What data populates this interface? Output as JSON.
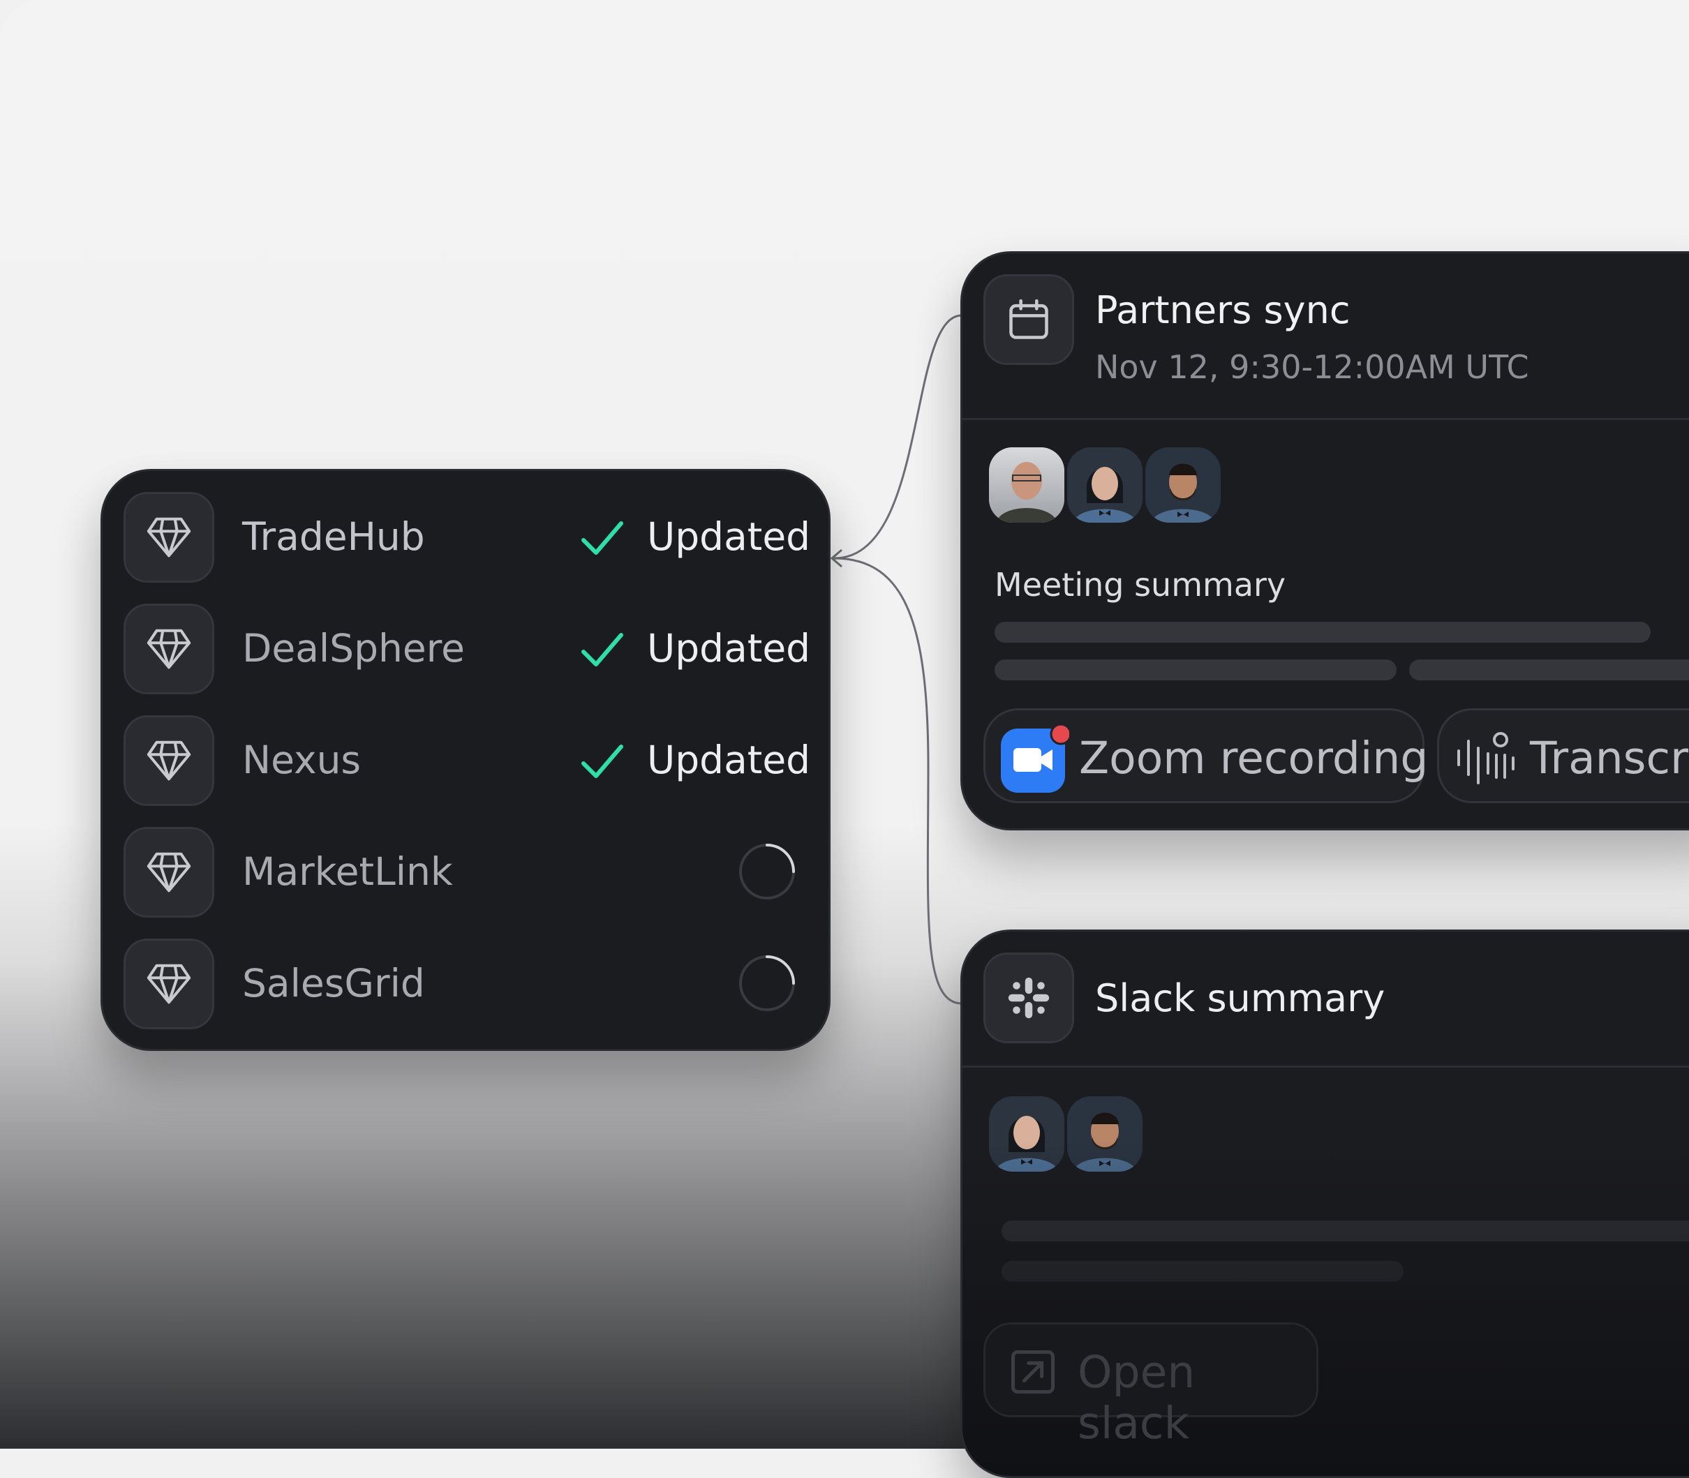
{
  "deals": {
    "items": [
      {
        "name": "TradeHub",
        "status": "Updated",
        "state": "done"
      },
      {
        "name": "DealSphere",
        "status": "Updated",
        "state": "done"
      },
      {
        "name": "Nexus",
        "status": "Updated",
        "state": "done"
      },
      {
        "name": "MarketLink",
        "status": "",
        "state": "loading"
      },
      {
        "name": "SalesGrid",
        "status": "",
        "state": "loading"
      }
    ],
    "icon": "diamond-icon"
  },
  "meeting": {
    "icon": "calendar-icon",
    "title": "Partners sync",
    "time": "Nov 12, 9:30-12:00AM UTC",
    "summary_label": "Meeting summary",
    "participants": 3,
    "zoom_label": "Zoom recording",
    "transcript_label": "Transcri"
  },
  "slack": {
    "icon": "slack-icon",
    "title": "Slack summary",
    "participants": 2,
    "open_label": "Open slack"
  },
  "colors": {
    "accent_check": "#2fe0a6",
    "card_bg": "#1b1c20",
    "zoom_blue": "#2d7cf6",
    "notification_red": "#e5484d"
  }
}
